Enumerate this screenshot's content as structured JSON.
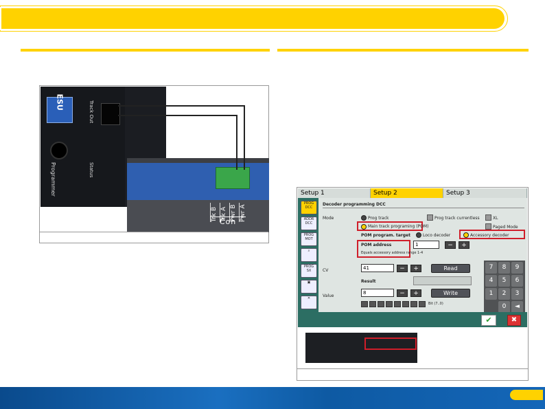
{
  "left_figure": {
    "device_logo": "ESU",
    "labels": {
      "track_out": "Track Out",
      "status": "Status",
      "programmer": "Programmer",
      "con": "Con",
      "con_columns": [
        "Trk B",
        "Trk A",
        "Pwr B",
        "Pwr A"
      ]
    }
  },
  "right_figure": {
    "tabs": [
      "Setup 1",
      "Setup 2",
      "Setup 3"
    ],
    "active_tab": "Setup 2",
    "sidebar": [
      "PROG DCC",
      "ADDR DCC",
      "PROG MOT",
      "",
      "PROG SX",
      "",
      ""
    ],
    "title": "Decoder programming DCC",
    "mode_label": "Mode",
    "mode_options": {
      "prog_track": "Prog track",
      "prog_track_currentless": "Prog track currentless",
      "xl": "XL",
      "main_track": "Main track programing (POM)",
      "paged_mode": "Paged Mode"
    },
    "pom_target_label": "POM program. target",
    "loco_decoder": "Loco decoder",
    "accessory_decoder": "Accessory decoder",
    "pom_address_label": "POM address",
    "pom_address_value": "1",
    "pom_hint": "Equals accessory address range 1-4",
    "cv_label": "CV",
    "cv_value": "41",
    "read_button": "Read",
    "result_label": "Result",
    "value_label": "Value",
    "value_value": "8",
    "write_button": "Write",
    "bit_label": "Bit (7..0)",
    "keypad": [
      "7",
      "8",
      "9",
      "4",
      "5",
      "6",
      "1",
      "2",
      "3",
      "0",
      "◄"
    ],
    "ok_icon": "checkmark-icon",
    "cancel_icon": "x-icon",
    "colors": {
      "accent": "#ffd200",
      "highlight": "#d01e2a",
      "screen_frame": "#2c6e63"
    }
  }
}
